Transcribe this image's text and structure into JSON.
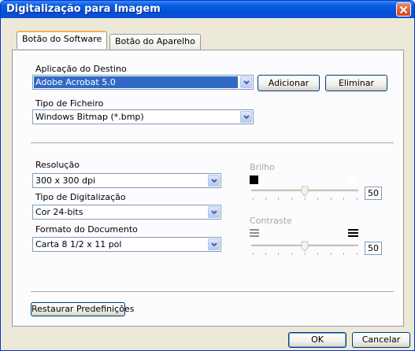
{
  "window": {
    "title": "Digitalização para Imagem"
  },
  "tabs": [
    {
      "label": "Botão do Software",
      "active": true
    },
    {
      "label": "Botão do Aparelho",
      "active": false
    }
  ],
  "destination": {
    "label": "Aplicação do Destino",
    "value": "Adobe Acrobat 5.0",
    "add_button": "Adicionar",
    "remove_button": "Eliminar"
  },
  "file_type": {
    "label": "Tipo de Ficheiro",
    "value": "Windows Bitmap (*.bmp)"
  },
  "resolution": {
    "label": "Resolução",
    "value": "300 x 300 dpi"
  },
  "scan_type": {
    "label": "Tipo de Digitalização",
    "value": "Cor 24-bits"
  },
  "document_size": {
    "label": "Formato do Documento",
    "value": "Carta 8 1/2 x 11 pol"
  },
  "brightness": {
    "label": "Brilho",
    "value": "50",
    "level_percent": 50
  },
  "contrast": {
    "label": "Contraste",
    "value": "50",
    "level_percent": 50
  },
  "restore_button": "Restaurar Predefinições",
  "footer": {
    "ok_button": "OK",
    "cancel_button": "Cancelar"
  },
  "colors": {
    "titlebar": "#0a5fe2",
    "selection": "#316ac5",
    "disabled_text": "#a9a79b"
  },
  "icons": {
    "close": "close-icon",
    "dropdown": "chevron-down-icon"
  }
}
